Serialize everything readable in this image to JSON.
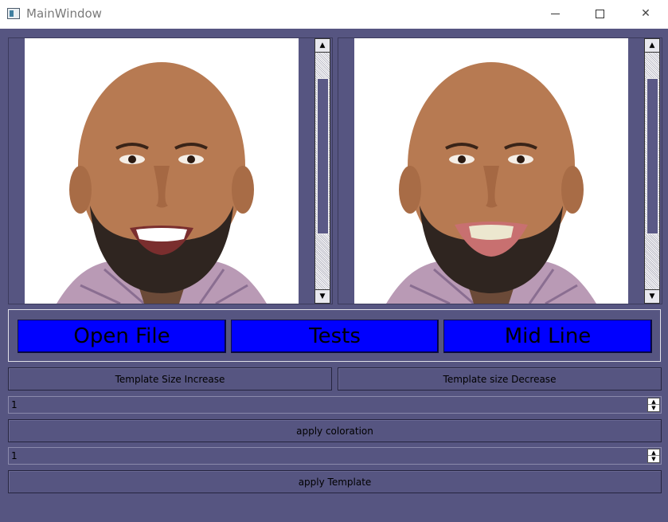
{
  "window": {
    "title": "MainWindow",
    "minimize_glyph": "",
    "maximize_glyph": "",
    "close_glyph": "✕"
  },
  "viewers": {
    "left": {
      "image": "original-face-photo"
    },
    "right": {
      "image": "edited-face-photo"
    },
    "scroll_up_glyph": "▲",
    "scroll_down_glyph": "▼"
  },
  "main_buttons": {
    "open_file": "Open File",
    "tests": "Tests",
    "mid_line": "Mid Line"
  },
  "template_buttons": {
    "increase": "Template Size Increase",
    "decrease": "Template size Decrease"
  },
  "coloration": {
    "spin_value": "1",
    "apply_label": "apply coloration"
  },
  "template": {
    "spin_value": "1",
    "apply_label": "apply Template"
  },
  "spin_glyphs": {
    "up": "▲",
    "down": "▼"
  },
  "colors": {
    "client_bg": "#565581",
    "big_button_bg": "#0000ff"
  }
}
